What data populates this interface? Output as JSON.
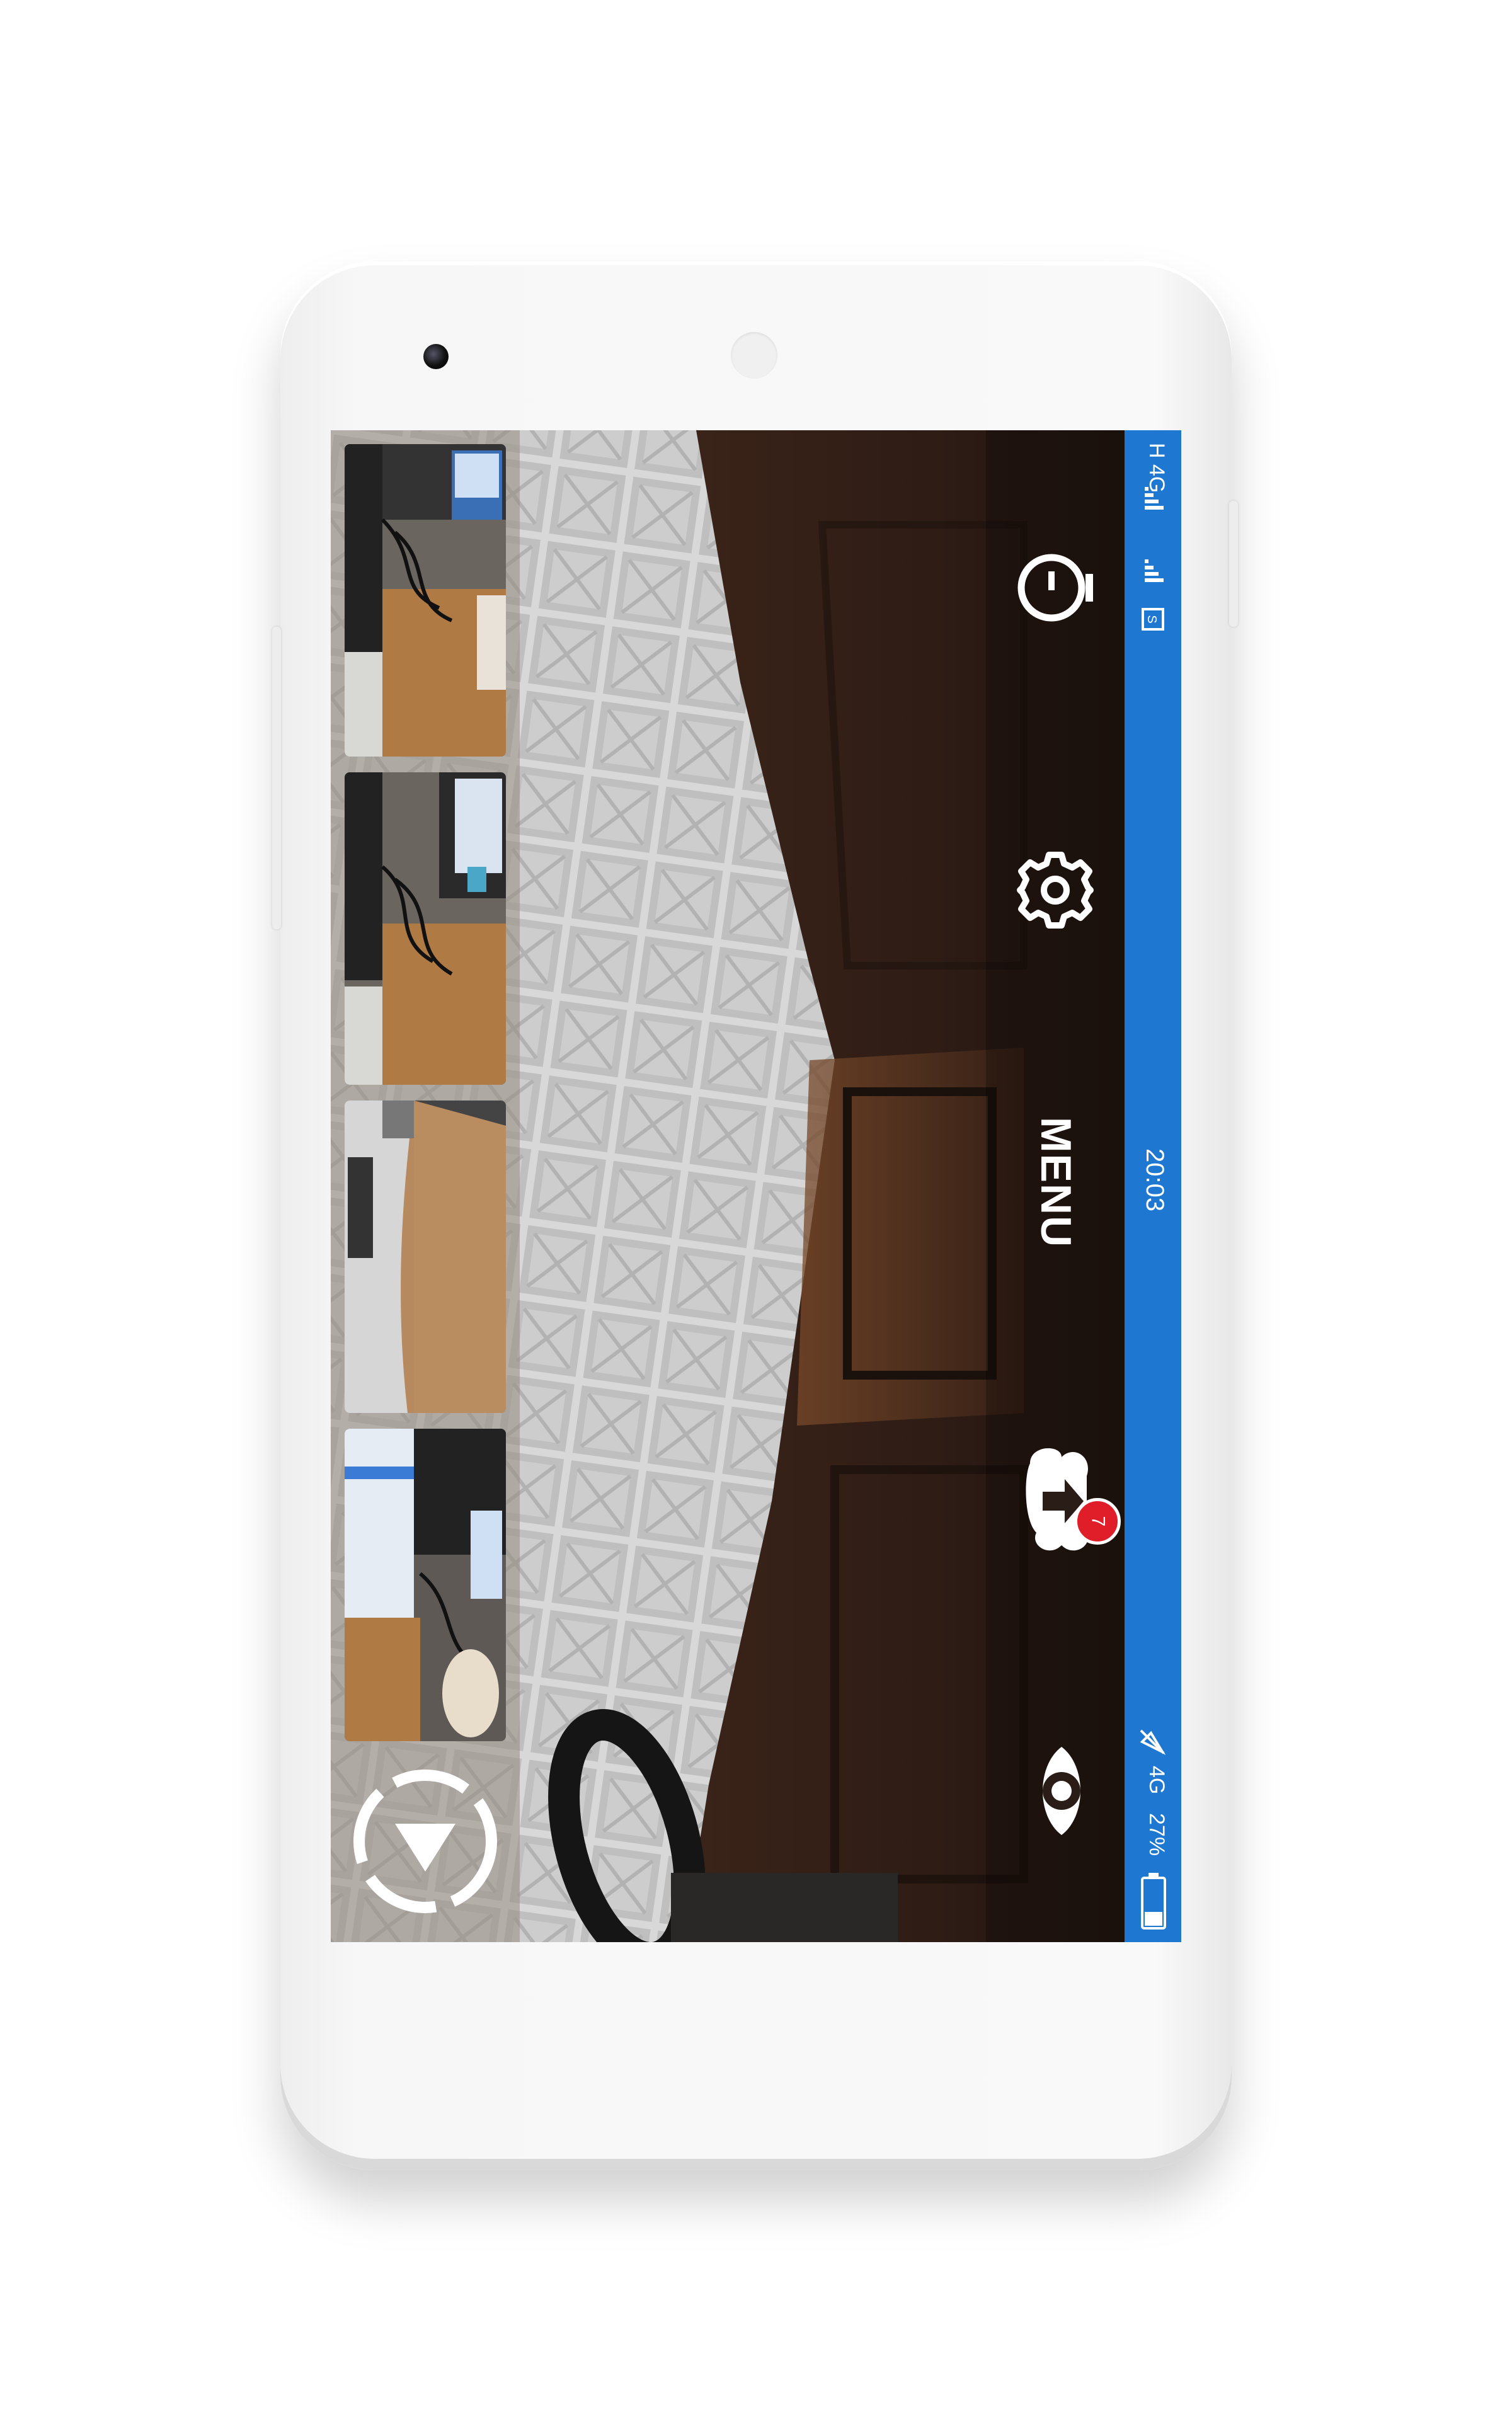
{
  "status_bar": {
    "network_top": "H 4G",
    "time": "20:03",
    "network_bottom": "4G",
    "battery": "27%"
  },
  "controls": {
    "menu_label": "MENU",
    "upload_badge_count": "7"
  },
  "icons": [
    "timer-icon",
    "gear-icon",
    "cloud-upload-icon",
    "eye-icon",
    "capture-icon"
  ],
  "thumbnails": [
    {
      "label": "thumbnail-1"
    },
    {
      "label": "thumbnail-2"
    },
    {
      "label": "thumbnail-3"
    },
    {
      "label": "thumbnail-4"
    }
  ],
  "colors": {
    "status_bar": "#1e78d2",
    "badge": "#e01e2a"
  }
}
